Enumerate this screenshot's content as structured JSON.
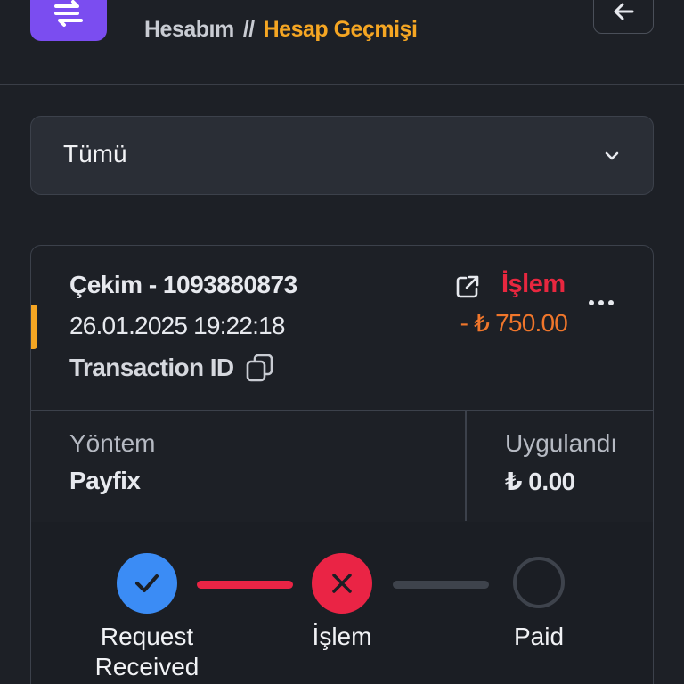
{
  "header": {
    "breadcrumb": [
      "Hesabım",
      "//",
      "Hesap Geçmişi"
    ],
    "icons": {
      "app": "swap-arrows-icon",
      "back": "arrow-left-icon"
    }
  },
  "filter": {
    "selected": "Tümü",
    "icon": "chevron-down-icon"
  },
  "transaction": {
    "title": "Çekim - 1093880873",
    "date": "26.01.2025 19:22:18",
    "id_label": "Transaction ID",
    "status": "İşlem",
    "amount": "- ₺ 750.00",
    "method_label": "Yöntem",
    "method_value": "Payfix",
    "applied_label": "Uygulandı",
    "applied_value": "₺ 0.00",
    "accent_color": "#f5a623",
    "status_color": "#e8273f",
    "amount_color": "#f0762b"
  },
  "progress": {
    "steps": [
      {
        "label": "Request Received",
        "state": "done",
        "icon": "check-icon",
        "color": "#3b8cf5"
      },
      {
        "label": "İşlem",
        "state": "failed",
        "icon": "x-icon",
        "color": "#ea2445"
      },
      {
        "label": "Paid",
        "state": "pending",
        "icon": "empty-circle-icon",
        "color": "#3e434c"
      }
    ]
  }
}
